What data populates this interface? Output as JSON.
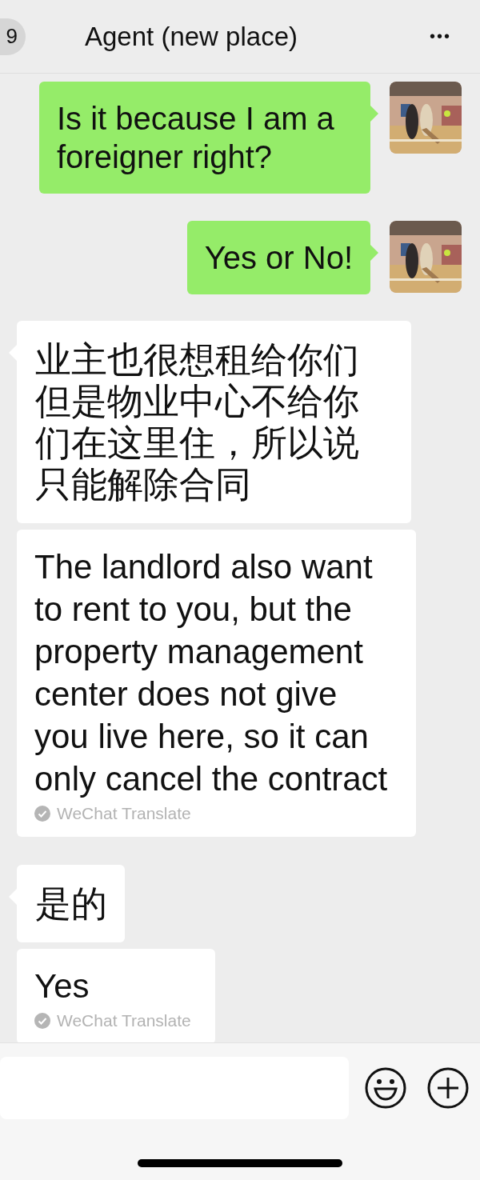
{
  "header": {
    "back_badge": "9",
    "title": "Agent (new place)",
    "menu": "•••"
  },
  "messages": [
    {
      "outgoing": true,
      "kind": "text",
      "text": "Is it because I am a foreigner right?"
    },
    {
      "outgoing": true,
      "kind": "text",
      "text": "Yes or No!"
    },
    {
      "outgoing": false,
      "kind": "text",
      "text": "业主也很想租给你们但是物业中心不给你们在这里住，所以说只能解除合同"
    },
    {
      "outgoing": false,
      "kind": "translation",
      "text": "The landlord also want to rent to you, but the property management center does not give you live here, so it can only cancel the contract",
      "label": "WeChat Translate"
    },
    {
      "outgoing": false,
      "kind": "text",
      "text": "是的"
    },
    {
      "outgoing": false,
      "kind": "translation",
      "text": "Yes",
      "label": "WeChat Translate"
    }
  ]
}
